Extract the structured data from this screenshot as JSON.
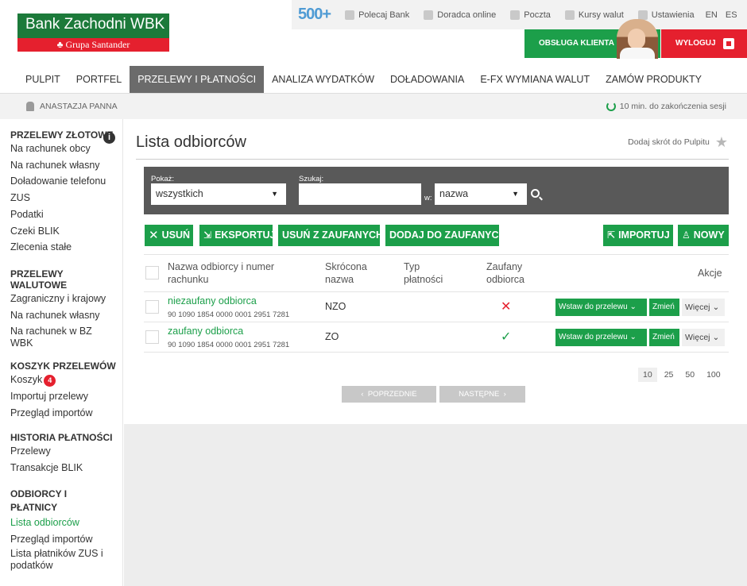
{
  "brand": {
    "bank_name": "Bank Zachodni WBK",
    "group_name": "Grupa Santander"
  },
  "topbar": {
    "promo": "500+",
    "links": [
      {
        "label": "Polecaj Bank",
        "icon": "recommend-icon"
      },
      {
        "label": "Doradca online",
        "icon": "advisor-icon"
      },
      {
        "label": "Poczta",
        "icon": "mail-icon"
      },
      {
        "label": "Kursy walut",
        "icon": "exchange-icon"
      },
      {
        "label": "Ustawienia",
        "icon": "gear-icon"
      }
    ],
    "lang_en": "EN",
    "lang_es": "ES",
    "customer_service": "OBSŁUGA KLIENTA",
    "logout": "WYLOGUJ"
  },
  "nav": {
    "items": [
      "PULPIT",
      "PORTFEL",
      "PRZELEWY I PŁATNOŚCI",
      "ANALIZA WYDATKÓW",
      "DOŁADOWANIA",
      "E-FX WYMIANA WALUT",
      "ZAMÓW PRODUKTY"
    ],
    "active_index": 2
  },
  "userbar": {
    "user_name": "ANASTAZJA PANNA",
    "session": "10 min. do zakończenia sesji"
  },
  "sidebar": {
    "groups": [
      {
        "title": "PRZELEWY ZŁOTOWE",
        "items": [
          "Na rachunek obcy",
          "Na rachunek własny",
          "Doładowanie telefonu",
          "ZUS",
          "Podatki",
          "Czeki BLIK",
          "Zlecenia stałe"
        ]
      },
      {
        "title": "PRZELEWY WALUTOWE",
        "items": [
          "Zagraniczny i krajowy",
          "Na rachunek własny",
          "Na rachunek w BZ WBK"
        ]
      },
      {
        "title": "KOSZYK PRZELEWÓW",
        "items": [
          "Koszyk",
          "Importuj przelewy",
          "Przegląd importów"
        ],
        "badge": "4"
      },
      {
        "title": "HISTORIA PŁATNOŚCI",
        "items": [
          "Przelewy",
          "Transakcje BLIK"
        ]
      },
      {
        "title": "ODBIORCY I PŁATNICY",
        "items": [
          "Lista odbiorców",
          "Przegląd importów",
          "Lista płatników ZUS i podatków"
        ]
      }
    ]
  },
  "main": {
    "title": "Lista odbiorców",
    "shortcut": "Dodaj skrót do Pulpitu",
    "filter": {
      "show_label": "Pokaż:",
      "show_value": "wszystkich",
      "search_label": "Szukaj:",
      "search_value": "",
      "in_label": "w:",
      "in_value": "nazwa"
    },
    "buttons": {
      "delete": "USUŃ",
      "export": "EKSPORTUJ",
      "remove_trusted": "USUŃ Z ZAUFANYCH",
      "add_trusted": "DODAJ DO ZAUFANYCH",
      "import": "IMPORTUJ",
      "new": "NOWY"
    },
    "table": {
      "headers": {
        "name": "Nazwa odbiorcy i numer rachunku",
        "short": "Skrócona nazwa",
        "type": "Typ płatności",
        "trusted": "Zaufany odbiorca",
        "actions": "Akcje"
      },
      "rows": [
        {
          "name": "niezaufany odbiorca",
          "account": "90 1090 1854 0000 0001 2951 7281",
          "short": "NZO",
          "type": "",
          "trusted": false
        },
        {
          "name": "zaufany odbiorca",
          "account": "90 1090 1854 0000 0001 2951 7281",
          "short": "ZO",
          "type": "",
          "trusted": true
        }
      ],
      "row_actions": {
        "insert": "Wstaw do przelewu",
        "change": "Zmień",
        "more": "Więcej"
      }
    },
    "pagination": {
      "sizes": [
        "10",
        "25",
        "50",
        "100"
      ],
      "active_size": "10",
      "prev": "POPRZEDNIE",
      "next": "NASTĘPNE"
    }
  },
  "colors": {
    "green": "#1c9f4a",
    "red": "#e5202e",
    "nav_active": "#6b6b6b",
    "filter_bg": "#595959"
  }
}
